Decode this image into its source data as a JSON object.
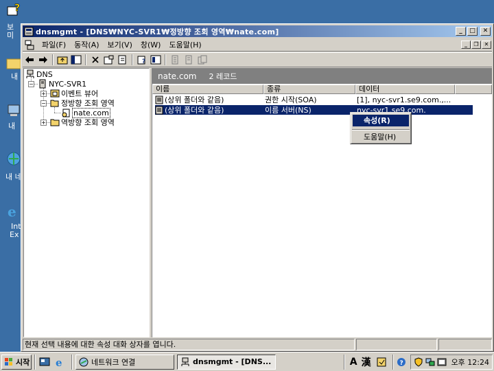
{
  "window": {
    "title": "dnsmgmt - [DNS₩NYC-SVR1₩정방향 조회 영역₩nate.com]"
  },
  "menubar": {
    "items": [
      "파일(F)",
      "동작(A)",
      "보기(V)",
      "창(W)",
      "도움말(H)"
    ]
  },
  "toolbar": {
    "buttons": [
      "back-icon",
      "forward-icon",
      "up-folder-icon",
      "show-hide-tree-icon",
      "delete-icon",
      "properties-icon",
      "refresh-icon",
      "export-icon",
      "help-icon",
      "console-icon",
      "record-icon",
      "record-icon-2",
      "record-icon-3"
    ]
  },
  "tree": {
    "root": "DNS",
    "server": "NYC-SVR1",
    "event_viewer": "이벤트 뷰어",
    "forward_zone": "정방향 조회 영역",
    "zone": "nate.com",
    "reverse_zone": "역방향 조회 영역"
  },
  "right_pane": {
    "header_title": "nate.com",
    "header_count": "2 레코드",
    "columns": [
      "이름",
      "종류",
      "데이터"
    ],
    "rows": [
      {
        "name": "(상위 폴더와 같음)",
        "type": "권한 시작(SOA)",
        "data": "[1], nyc-svr1.se9.com.,..."
      },
      {
        "name": "(상위 폴더와 같음)",
        "type": "이름 서버(NS)",
        "data": "nyc-svr1.se9.com."
      }
    ]
  },
  "context_menu": {
    "items": [
      "속성(R)",
      "도움말(H)"
    ]
  },
  "statusbar": {
    "text": "현재 선택 내용에 대한 속성 대화 상자를 엽니다."
  },
  "taskbar": {
    "start_label": "시작",
    "tasks": [
      "네트워크 연결",
      "dnsmgmt - [DNS..."
    ],
    "ime_a": "A",
    "ime_han": "漢",
    "clock": "오후 12:24"
  },
  "desktop": {
    "labels": [
      "보",
      "미",
      "내",
      "내",
      "내 네",
      "Int",
      "Ex"
    ]
  },
  "colors": {
    "desktop": "#3a6ea5",
    "title_start": "#0a246a",
    "title_end": "#a6caf0",
    "selection": "#0a246a",
    "chrome": "#d4d0c8"
  }
}
